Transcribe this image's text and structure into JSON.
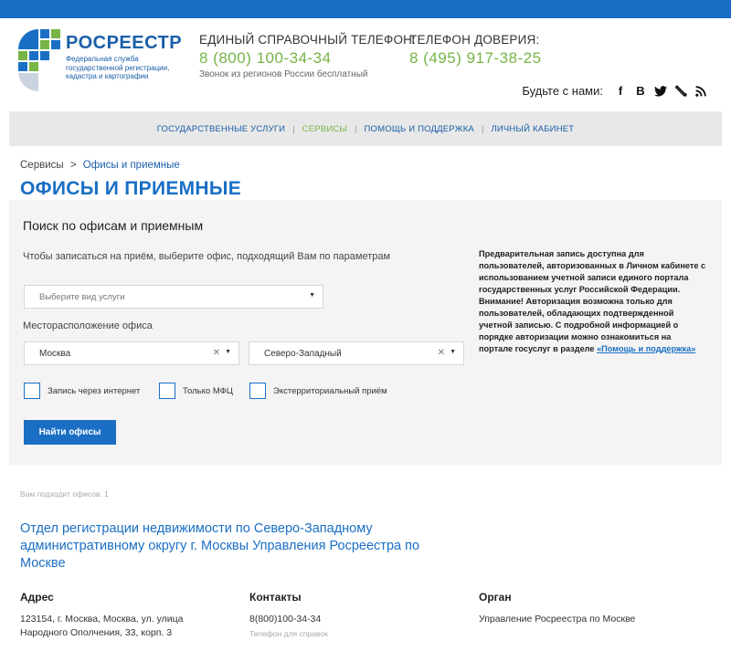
{
  "colors": {
    "brand_blue": "#1a6fc4",
    "accent_green": "#76b546",
    "panel_bg": "#f4f4f4",
    "nav_bg": "#e8e8e8"
  },
  "header": {
    "logo_title": "РОСРЕЕСТР",
    "logo_subtitle": "Федеральная служба государственной регистрации, кадастра и картографии",
    "phone1": {
      "label": "ЕДИНЫЙ СПРАВОЧНЫЙ ТЕЛЕФОН:",
      "number": "8 (800) 100-34-34",
      "note": "Звонок из регионов России бесплатный"
    },
    "phone2": {
      "label": "ТЕЛЕФОН ДОВЕРИЯ:",
      "number": "8 (495) 917-38-25"
    },
    "social_label": "Будьте с нами:",
    "social_icons": [
      "facebook-icon",
      "vk-icon",
      "twitter-icon",
      "livejournal-icon",
      "rss-icon"
    ]
  },
  "nav": {
    "items": [
      {
        "label": "ГОСУДАРСТВЕННЫЕ УСЛУГИ",
        "active": false
      },
      {
        "label": "СЕРВИСЫ",
        "active": true
      },
      {
        "label": "ПОМОЩЬ И ПОДДЕРЖКА",
        "active": false
      },
      {
        "label": "ЛИЧНЫЙ КАБИНЕТ",
        "active": false
      }
    ]
  },
  "breadcrumb": {
    "root": "Сервисы",
    "separator": ">",
    "current": "Офисы и приемные"
  },
  "page": {
    "title": "ОФИСЫ И ПРИЕМНЫЕ"
  },
  "search": {
    "title": "Поиск по офисам и приемным",
    "subtitle": "Чтобы записаться на приём, выберите офис, подходящий Вам по параметрам",
    "service_placeholder": "Выберите вид услуги",
    "location_label": "Месторасположение офиса",
    "city_value": "Москва",
    "district_value": "Северо-Западный",
    "checkboxes": [
      {
        "label": "Запись через интернет",
        "checked": false
      },
      {
        "label": "Только МФЦ",
        "checked": false
      },
      {
        "label": "Экстерриториальный приём",
        "checked": false
      }
    ],
    "button_label": "Найти офисы",
    "info_text": "Предварительная запись доступна для пользователей, авторизованных в Личном кабинете с использованием учетной записи единого портала государственных услуг Российской Федерации. Внимание! Авторизация возможна только для пользователей, обладающих подтвержденной учетной записью. С подробной информацией о порядке авторизации можно ознакомиться на портале госуслуг в разделе ",
    "info_link": "«Помощь и поддержка»"
  },
  "results": {
    "count_text": "Вам подходит офисов: 1",
    "office_title": "Отдел регистрации недвижимости по Северо-Западному административному округу г. Москвы Управления Росреестра по Москве",
    "address_head": "Адрес",
    "address_text": "123154, г. Москва, Москва, ул. улица Народного Ополчения, 33, корп. 3",
    "contacts_head": "Контакты",
    "contacts_phone": "8(800)100-34-34",
    "contacts_note": "Телефон для справок",
    "organ_head": "Орган",
    "organ_text": "Управление Росреестра по Москве"
  }
}
